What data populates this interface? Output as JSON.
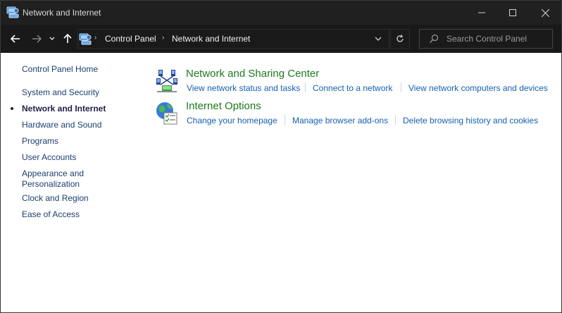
{
  "window": {
    "title": "Network and Internet"
  },
  "address_bar": {
    "breadcrumbs": [
      "Control Panel",
      "Network and Internet"
    ]
  },
  "search": {
    "placeholder": "Search Control Panel",
    "value": ""
  },
  "sidebar": {
    "home": "Control Panel Home",
    "items": [
      "System and Security",
      "Network and Internet",
      "Hardware and Sound",
      "Programs",
      "User Accounts",
      "Appearance and",
      "Personalization",
      "Clock and Region",
      "Ease of Access"
    ],
    "current": "Network and Internet"
  },
  "categories": [
    {
      "title": "Network and Sharing Center",
      "icon": "network-sharing-icon",
      "tasks": [
        "View network status and tasks",
        "Connect to a network",
        "View network computers and devices"
      ]
    },
    {
      "title": "Internet Options",
      "icon": "internet-options-icon",
      "tasks": [
        "Change your homepage",
        "Manage browser add-ons",
        "Delete browsing history and cookies"
      ]
    }
  ],
  "colors": {
    "title_bar": "#202020",
    "category_title": "#1d7a1d",
    "task_link": "#1560b0",
    "sidebar_link": "#1c3e6e"
  }
}
